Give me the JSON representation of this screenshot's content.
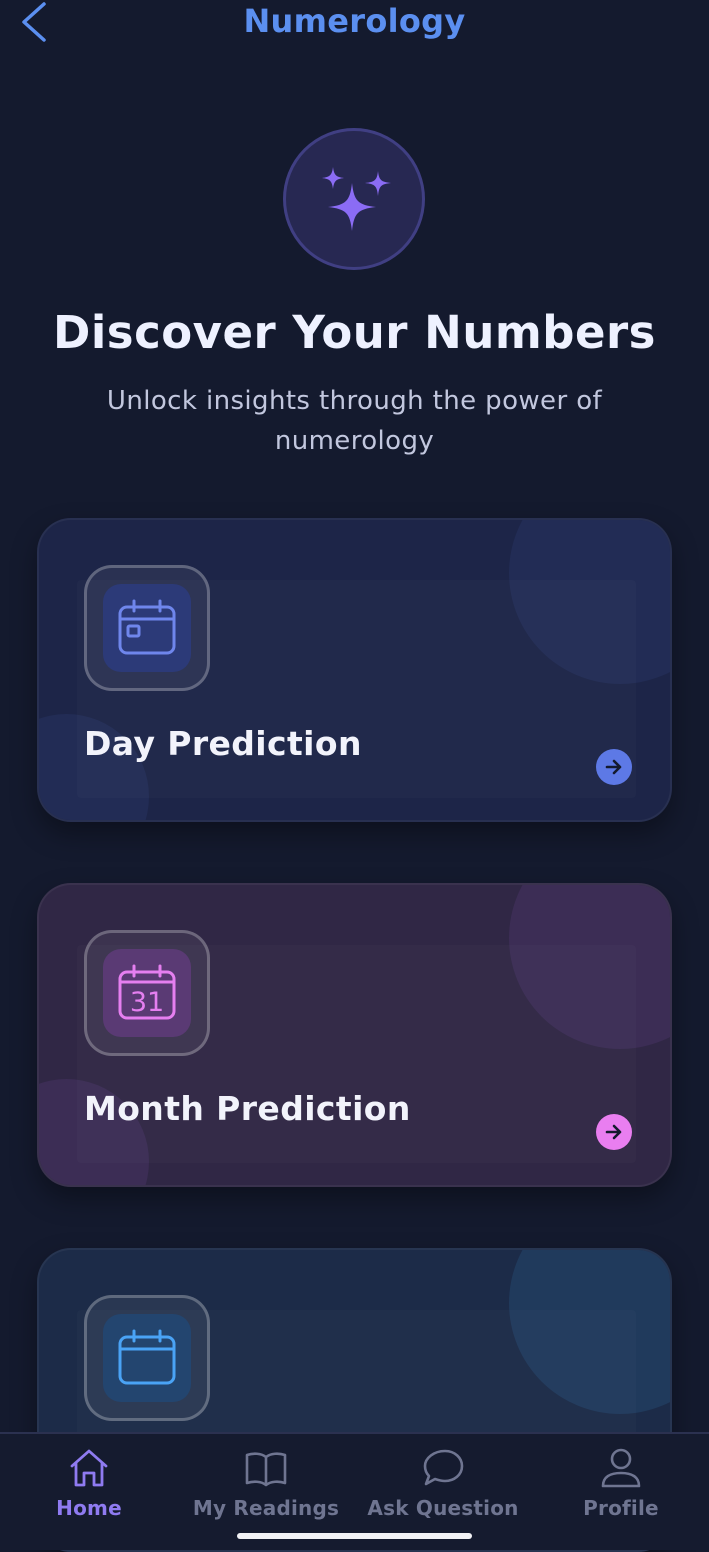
{
  "header": {
    "title": "Numerology",
    "back_icon": "chevron-left-icon",
    "accent_color": "#5b8ff0"
  },
  "hero": {
    "icon": "sparkles-icon",
    "title": "Discover Your Numbers",
    "subtitle": "Unlock insights through the power of numerology"
  },
  "cards": [
    {
      "title": "Day Prediction",
      "icon": "calendar-day-icon",
      "accent": "#5d79e6",
      "arrow_icon": "arrow-right-icon"
    },
    {
      "title": "Month Prediction",
      "icon": "calendar-31-icon",
      "icon_text": "31",
      "accent": "#e97ef0",
      "arrow_icon": "arrow-right-icon"
    },
    {
      "title": "",
      "icon": "calendar-icon",
      "accent": "#4aa3f5"
    }
  ],
  "tabbar": {
    "items": [
      {
        "label": "Home",
        "icon": "home-icon",
        "active": true
      },
      {
        "label": "My Readings",
        "icon": "book-icon",
        "active": false
      },
      {
        "label": "Ask Question",
        "icon": "chat-bubble-icon",
        "active": false
      },
      {
        "label": "Profile",
        "icon": "person-icon",
        "active": false
      }
    ],
    "active_color": "#8f7bf1",
    "inactive_color": "#6f7591"
  }
}
